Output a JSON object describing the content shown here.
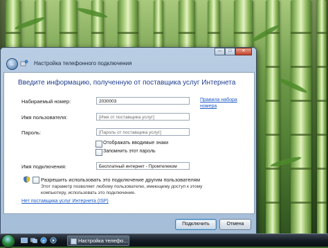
{
  "window": {
    "title": "Настройка телефонного подключения",
    "controls": {
      "minimize": "—",
      "maximize": "□",
      "close": "✕"
    }
  },
  "form": {
    "heading": "Введите информацию, полученную от поставщика услуг Интернета",
    "phone_label": "Набираемый номер:",
    "phone_value": "2030003",
    "dialing_rules_link": "Правила набора номера",
    "user_label": "Имя пользователя:",
    "user_value": "[Имя от поставщика услуг]",
    "password_label": "Пароль:",
    "password_value": "[Пароль от поставщика услуг]",
    "show_chars_label": "Отображать вводимые знаки",
    "remember_label": "Запомнить этот пароль",
    "connection_name_label": "Имя подключения:",
    "connection_name_value": "Бесплатный интернет - Промтелеком",
    "allow_others_label": "Разрешить использовать это подключение другим пользователям",
    "allow_others_note": "Этот параметр позволяет любому пользователю, имеющему доступ к этому компьютеру, использовать это подключение.",
    "no_isp_link": "Нет поставщика услуг Интернета (ISP)"
  },
  "buttons": {
    "connect": "Подключить",
    "cancel": "Отмена"
  },
  "taskbar": {
    "task_label": "Настройка телефо..."
  },
  "colors": {
    "instruction": "#1e3d8f",
    "link": "#1c5bc7",
    "window_frame": "#b9cde3"
  }
}
